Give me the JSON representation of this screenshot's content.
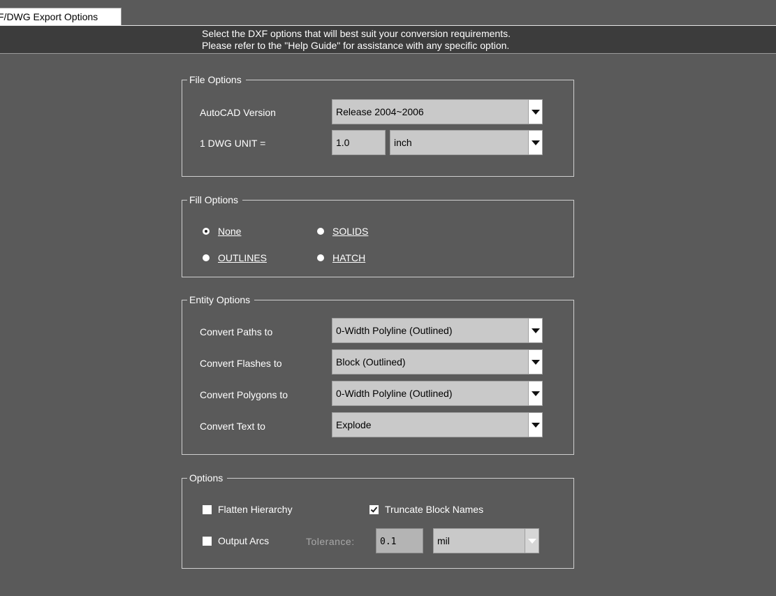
{
  "tab": {
    "label": "F/DWG Export Options"
  },
  "banner": {
    "line1": "Select the DXF options that will best suit your conversion requirements.",
    "line2": "Please refer to the \"Help Guide\" for assistance with any specific option."
  },
  "file_options": {
    "legend": "File Options",
    "autocad_version_label": "AutoCAD Version",
    "autocad_version_value": "Release 2004~2006",
    "dwg_unit_label": "1 DWG UNIT =",
    "dwg_unit_value": "1.0",
    "dwg_unit_type": "inch"
  },
  "fill_options": {
    "legend": "Fill  Options",
    "selected": "None",
    "none_label": "None",
    "solids_label": "SOLIDS",
    "outlines_label": "OUTLINES",
    "hatch_label": "HATCH"
  },
  "entity_options": {
    "legend": "Entity Options",
    "rows": [
      {
        "label": "Convert Paths to",
        "value": "0-Width Polyline (Outlined)"
      },
      {
        "label": "Convert Flashes to",
        "value": "Block (Outlined)"
      },
      {
        "label": "Convert Polygons to",
        "value": "0-Width Polyline (Outlined)"
      },
      {
        "label": "Convert Text to",
        "value": "Explode"
      }
    ]
  },
  "options": {
    "legend": "Options",
    "flatten_hierarchy_label": "Flatten Hierarchy",
    "flatten_hierarchy_checked": false,
    "truncate_block_names_label": "Truncate Block Names",
    "truncate_block_names_checked": true,
    "output_arcs_label": "Output Arcs",
    "output_arcs_checked": false,
    "tolerance_label": "Tolerance:",
    "tolerance_value": "0.1",
    "tolerance_unit": "mil"
  },
  "colors": {
    "background": "#5a5a5a",
    "banner": "#3c3c3c",
    "field": "#c9c9c9"
  }
}
